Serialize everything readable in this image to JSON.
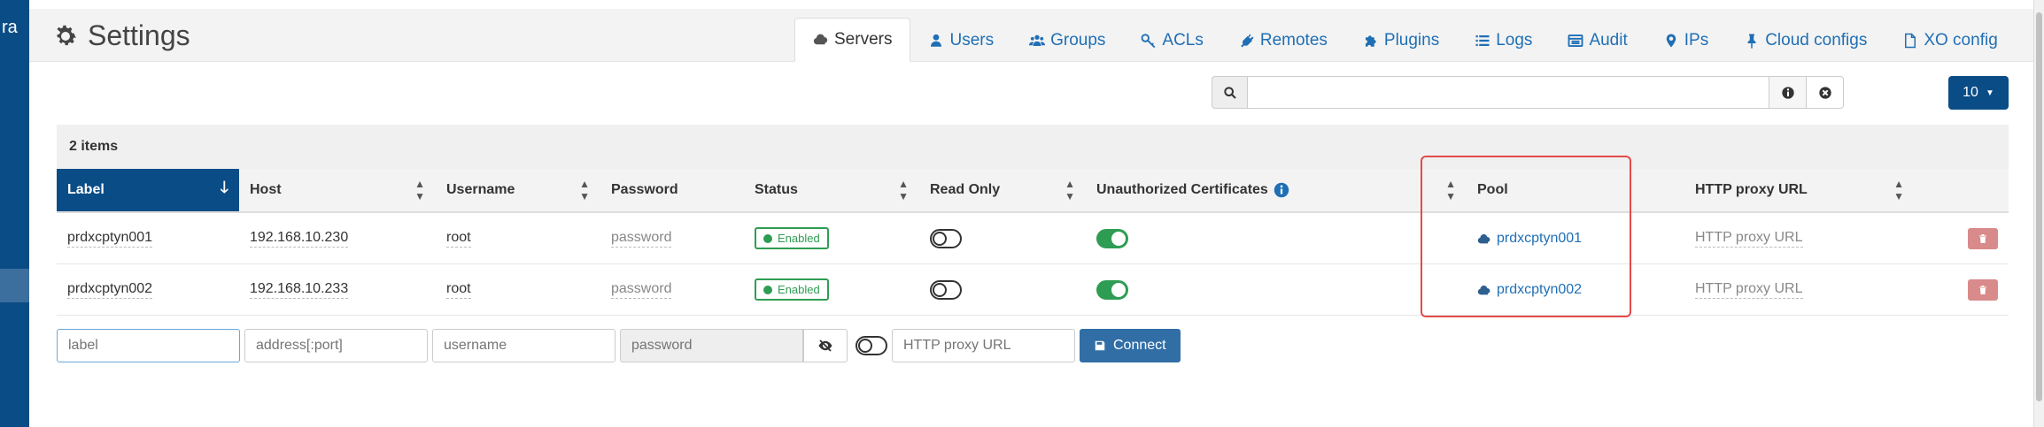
{
  "app": {
    "brand_fragment": "ra"
  },
  "header": {
    "title": "Settings"
  },
  "tabs": [
    {
      "label": "Servers",
      "icon": "cloud-icon",
      "active": true
    },
    {
      "label": "Users",
      "icon": "user-icon"
    },
    {
      "label": "Groups",
      "icon": "users-icon"
    },
    {
      "label": "ACLs",
      "icon": "key-icon"
    },
    {
      "label": "Remotes",
      "icon": "plug-icon"
    },
    {
      "label": "Plugins",
      "icon": "puzzle-icon"
    },
    {
      "label": "Logs",
      "icon": "list-icon"
    },
    {
      "label": "Audit",
      "icon": "window-icon"
    },
    {
      "label": "IPs",
      "icon": "map-marker-icon"
    },
    {
      "label": "Cloud configs",
      "icon": "pin-icon"
    },
    {
      "label": "XO config",
      "icon": "file-icon"
    }
  ],
  "search": {
    "value": "",
    "placeholder": ""
  },
  "page_size": {
    "label": "10"
  },
  "table": {
    "item_count": "2 items",
    "columns": [
      {
        "label": "Label",
        "sorted": true
      },
      {
        "label": "Host"
      },
      {
        "label": "Username"
      },
      {
        "label": "Password"
      },
      {
        "label": "Status"
      },
      {
        "label": "Read Only"
      },
      {
        "label": "Unauthorized Certificates"
      },
      {
        "label": "Pool"
      },
      {
        "label": "HTTP proxy URL"
      }
    ],
    "rows": [
      {
        "label": "prdxcptyn001",
        "host": "192.168.10.230",
        "username": "root",
        "password": "password",
        "status": "Enabled",
        "read_only": false,
        "unauthorized_certificates": true,
        "pool": "prdxcptyn001",
        "http_proxy_url": "HTTP proxy URL"
      },
      {
        "label": "prdxcptyn002",
        "host": "192.168.10.233",
        "username": "root",
        "password": "password",
        "status": "Enabled",
        "read_only": false,
        "unauthorized_certificates": true,
        "pool": "prdxcptyn002",
        "http_proxy_url": "HTTP proxy URL"
      }
    ]
  },
  "new_server": {
    "label_placeholder": "label",
    "host_placeholder": "address[:port]",
    "username_placeholder": "username",
    "password_placeholder": "password",
    "proxy_placeholder": "HTTP proxy URL",
    "connect_label": "Connect"
  },
  "colors": {
    "primary": "#0a4c86",
    "link": "#1f6fb5",
    "success": "#2e9d53",
    "danger": "#d98a8a",
    "highlight": "#e24a4a"
  }
}
